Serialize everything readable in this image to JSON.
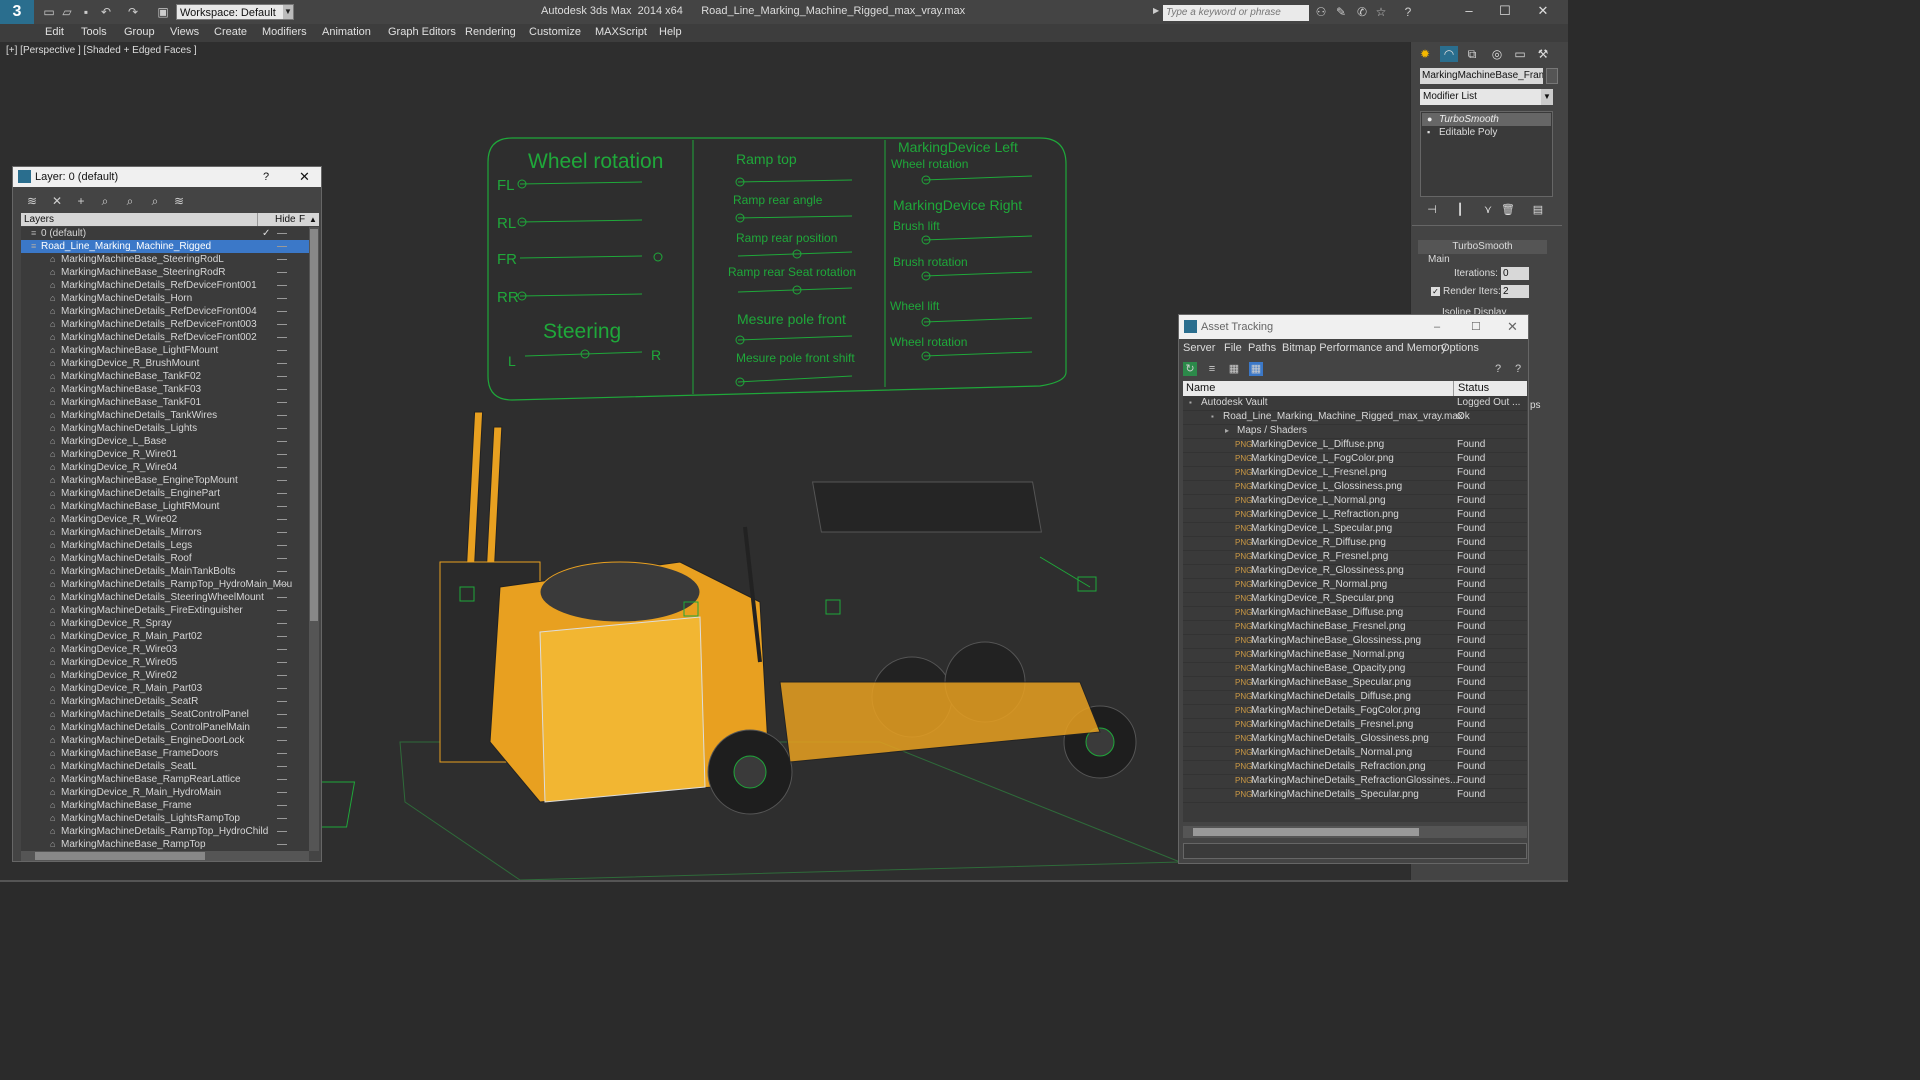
{
  "app": {
    "logo": "3",
    "title": "Autodesk 3ds Max  2014 x64      Road_Line_Marking_Machine_Rigged_max_vray.max",
    "workspace": "Workspace: Default",
    "search_placeholder": "Type a keyword or phrase"
  },
  "menus": [
    "Edit",
    "Tools",
    "Group",
    "Views",
    "Create",
    "Modifiers",
    "Animation",
    "Graph Editors",
    "Rendering",
    "Customize",
    "MAXScript",
    "Help"
  ],
  "viewport": {
    "label": "[+] [Perspective ] [Shaded + Edged Faces ]"
  },
  "rig_panel": {
    "wheel_rotation": "Wheel rotation",
    "fl": "FL",
    "rl": "RL",
    "fr": "FR",
    "rr": "RR",
    "steering": "Steering",
    "l": "L",
    "r": "R",
    "ramp_top": "Ramp top",
    "ramp_rear_angle": "Ramp rear angle",
    "ramp_rear_position": "Ramp rear position",
    "ramp_rear_seat_rotation": "Ramp rear Seat rotation",
    "mesure_pole_front": "Mesure  pole  front",
    "mesure_pole_front_shift": "Mesure pole front shift",
    "marking_device_left": "MarkingDevice Left",
    "left_wheel_rotation": "Wheel rotation",
    "marking_device_right": "MarkingDevice Right",
    "brush_lift": "Brush lift",
    "brush_rotation": "Brush rotation",
    "wheel_lift": "Wheel lift",
    "right_wheel_rotation": "Wheel rotation"
  },
  "command_panel": {
    "object_name": "MarkingMachineBase_FrameD",
    "modifier_list": "Modifier List",
    "stack": [
      "TurboSmooth",
      "Editable Poly"
    ],
    "rollout_title": "TurboSmooth",
    "main_label": "Main",
    "iterations_label": "Iterations:",
    "iterations_value": "0",
    "render_iters_label": "Render Iters:",
    "render_iters_value": "2",
    "isoline_label": "Isoline Display",
    "side_text": "ps"
  },
  "layer_panel": {
    "title": "Layer: 0 (default)",
    "help": "?",
    "close": "✕",
    "col_layers": "Layers",
    "col_hide": "Hide",
    "col_f": "F",
    "layers": [
      {
        "name": "0 (default)",
        "level": 0
      },
      {
        "name": "Road_Line_Marking_Machine_Rigged",
        "level": 0,
        "selected": true
      },
      {
        "name": "MarkingMachineBase_SteeringRodL",
        "level": 1
      },
      {
        "name": "MarkingMachineBase_SteeringRodR",
        "level": 1
      },
      {
        "name": "MarkingMachineDetails_RefDeviceFront001",
        "level": 1
      },
      {
        "name": "MarkingMachineDetails_Horn",
        "level": 1
      },
      {
        "name": "MarkingMachineDetails_RefDeviceFront004",
        "level": 1
      },
      {
        "name": "MarkingMachineDetails_RefDeviceFront003",
        "level": 1
      },
      {
        "name": "MarkingMachineDetails_RefDeviceFront002",
        "level": 1
      },
      {
        "name": "MarkingMachineBase_LightFMount",
        "level": 1
      },
      {
        "name": "MarkingDevice_R_BrushMount",
        "level": 1
      },
      {
        "name": "MarkingMachineBase_TankF02",
        "level": 1
      },
      {
        "name": "MarkingMachineBase_TankF03",
        "level": 1
      },
      {
        "name": "MarkingMachineBase_TankF01",
        "level": 1
      },
      {
        "name": "MarkingMachineDetails_TankWires",
        "level": 1
      },
      {
        "name": "MarkingMachineDetails_Lights",
        "level": 1
      },
      {
        "name": "MarkingDevice_L_Base",
        "level": 1
      },
      {
        "name": "MarkingDevice_R_Wire01",
        "level": 1
      },
      {
        "name": "MarkingDevice_R_Wire04",
        "level": 1
      },
      {
        "name": "MarkingMachineBase_EngineTopMount",
        "level": 1
      },
      {
        "name": "MarkingMachineDetails_EnginePart",
        "level": 1
      },
      {
        "name": "MarkingMachineBase_LightRMount",
        "level": 1
      },
      {
        "name": "MarkingDevice_R_Wire02",
        "level": 1
      },
      {
        "name": "MarkingMachineDetails_Mirrors",
        "level": 1
      },
      {
        "name": "MarkingMachineDetails_Legs",
        "level": 1
      },
      {
        "name": "MarkingMachineDetails_Roof",
        "level": 1
      },
      {
        "name": "MarkingMachineDetails_MainTankBolts",
        "level": 1
      },
      {
        "name": "MarkingMachineDetails_RampTop_HydroMain_Mou",
        "level": 1
      },
      {
        "name": "MarkingMachineDetails_SteeringWheelMount",
        "level": 1
      },
      {
        "name": "MarkingMachineDetails_FireExtinguisher",
        "level": 1
      },
      {
        "name": "MarkingDevice_R_Spray",
        "level": 1
      },
      {
        "name": "MarkingDevice_R_Main_Part02",
        "level": 1
      },
      {
        "name": "MarkingDevice_R_Wire03",
        "level": 1
      },
      {
        "name": "MarkingDevice_R_Wire05",
        "level": 1
      },
      {
        "name": "MarkingDevice_R_Wire02",
        "level": 1
      },
      {
        "name": "MarkingDevice_R_Main_Part03",
        "level": 1
      },
      {
        "name": "MarkingMachineDetails_SeatR",
        "level": 1
      },
      {
        "name": "MarkingMachineDetails_SeatControlPanel",
        "level": 1
      },
      {
        "name": "MarkingMachineDetails_ControlPanelMain",
        "level": 1
      },
      {
        "name": "MarkingMachineDetails_EngineDoorLock",
        "level": 1
      },
      {
        "name": "MarkingMachineBase_FrameDoors",
        "level": 1
      },
      {
        "name": "MarkingMachineDetails_SeatL",
        "level": 1
      },
      {
        "name": "MarkingMachineBase_RampRearLattice",
        "level": 1
      },
      {
        "name": "MarkingDevice_R_Main_HydroMain",
        "level": 1
      },
      {
        "name": "MarkingMachineBase_Frame",
        "level": 1
      },
      {
        "name": "MarkingMachineDetails_LightsRampTop",
        "level": 1
      },
      {
        "name": "MarkingMachineDetails_RampTop_HydroChild",
        "level": 1
      },
      {
        "name": "MarkingMachineBase_RampTop",
        "level": 1
      }
    ]
  },
  "asset_tracking": {
    "title": "Asset Tracking",
    "menu": [
      "Server",
      "File",
      "Paths",
      "Bitmap Performance and Memory",
      "Options"
    ],
    "col_name": "Name",
    "col_status": "Status",
    "rows": [
      {
        "name": "Autodesk Vault",
        "status": "Logged Out ...",
        "level": 0
      },
      {
        "name": "Road_Line_Marking_Machine_Rigged_max_vray.max",
        "status": "Ok",
        "level": 1
      },
      {
        "name": "Maps / Shaders",
        "status": "",
        "level": 2
      },
      {
        "name": "MarkingDevice_L_Diffuse.png",
        "status": "Found",
        "level": 3
      },
      {
        "name": "MarkingDevice_L_FogColor.png",
        "status": "Found",
        "level": 3
      },
      {
        "name": "MarkingDevice_L_Fresnel.png",
        "status": "Found",
        "level": 3
      },
      {
        "name": "MarkingDevice_L_Glossiness.png",
        "status": "Found",
        "level": 3
      },
      {
        "name": "MarkingDevice_L_Normal.png",
        "status": "Found",
        "level": 3
      },
      {
        "name": "MarkingDevice_L_Refraction.png",
        "status": "Found",
        "level": 3
      },
      {
        "name": "MarkingDevice_L_Specular.png",
        "status": "Found",
        "level": 3
      },
      {
        "name": "MarkingDevice_R_Diffuse.png",
        "status": "Found",
        "level": 3
      },
      {
        "name": "MarkingDevice_R_Fresnel.png",
        "status": "Found",
        "level": 3
      },
      {
        "name": "MarkingDevice_R_Glossiness.png",
        "status": "Found",
        "level": 3
      },
      {
        "name": "MarkingDevice_R_Normal.png",
        "status": "Found",
        "level": 3
      },
      {
        "name": "MarkingDevice_R_Specular.png",
        "status": "Found",
        "level": 3
      },
      {
        "name": "MarkingMachineBase_Diffuse.png",
        "status": "Found",
        "level": 3
      },
      {
        "name": "MarkingMachineBase_Fresnel.png",
        "status": "Found",
        "level": 3
      },
      {
        "name": "MarkingMachineBase_Glossiness.png",
        "status": "Found",
        "level": 3
      },
      {
        "name": "MarkingMachineBase_Normal.png",
        "status": "Found",
        "level": 3
      },
      {
        "name": "MarkingMachineBase_Opacity.png",
        "status": "Found",
        "level": 3
      },
      {
        "name": "MarkingMachineBase_Specular.png",
        "status": "Found",
        "level": 3
      },
      {
        "name": "MarkingMachineDetails_Diffuse.png",
        "status": "Found",
        "level": 3
      },
      {
        "name": "MarkingMachineDetails_FogColor.png",
        "status": "Found",
        "level": 3
      },
      {
        "name": "MarkingMachineDetails_Fresnel.png",
        "status": "Found",
        "level": 3
      },
      {
        "name": "MarkingMachineDetails_Glossiness.png",
        "status": "Found",
        "level": 3
      },
      {
        "name": "MarkingMachineDetails_Normal.png",
        "status": "Found",
        "level": 3
      },
      {
        "name": "MarkingMachineDetails_Refraction.png",
        "status": "Found",
        "level": 3
      },
      {
        "name": "MarkingMachineDetails_RefractionGlossines...",
        "status": "Found",
        "level": 3
      },
      {
        "name": "MarkingMachineDetails_Specular.png",
        "status": "Found",
        "level": 3
      }
    ]
  },
  "colors": {
    "rig_green": "#1fa83a",
    "machine_orange": "#e8a020",
    "selection_blue": "#3b78c8",
    "bg_dark": "#2e2e2e"
  }
}
